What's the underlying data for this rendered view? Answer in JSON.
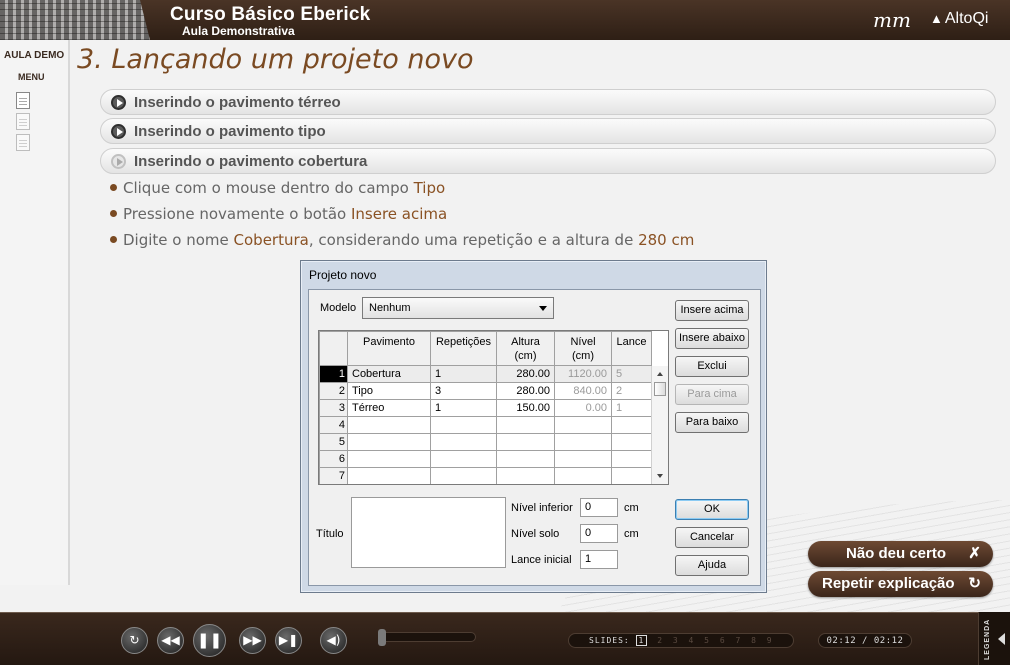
{
  "header": {
    "course_title": "Curso Básico Eberick",
    "course_subtitle": "Aula Demonstrativa",
    "logo_mm": "mm",
    "logo_altoqi": "AltoQi"
  },
  "sidebar": {
    "aula_demo": "AULA DEMO",
    "menu": "MENU"
  },
  "main": {
    "section_title": "3. Lançando um projeto novo",
    "accordion": [
      {
        "label": "Inserindo o pavimento térreo"
      },
      {
        "label": "Inserindo o pavimento tipo"
      },
      {
        "label": "Inserindo o pavimento cobertura"
      }
    ],
    "bullets": [
      {
        "pre": "Clique com o mouse dentro do campo ",
        "hl": "Tipo",
        "post": "",
        "hl2": ""
      },
      {
        "pre": "Pressione novamente o botão ",
        "hl": "Insere acima",
        "post": "",
        "hl2": ""
      },
      {
        "pre": "Digite o nome ",
        "hl": "Cobertura",
        "post": ", considerando uma repetição e a altura de ",
        "hl2": "280 cm"
      }
    ]
  },
  "dialog": {
    "title": "Projeto novo",
    "modelo_label": "Modelo",
    "modelo_value": "Nenhum",
    "columns": [
      "Pavimento",
      "Repetições",
      "Altura\n(cm)",
      "Nível\n(cm)",
      "Lance"
    ],
    "rows": [
      {
        "n": "1",
        "pavimento": "Cobertura",
        "rep": "1",
        "altura": "280.00",
        "nivel": "1120.00",
        "lance": "5"
      },
      {
        "n": "2",
        "pavimento": "Tipo",
        "rep": "3",
        "altura": "280.00",
        "nivel": "840.00",
        "lance": "2"
      },
      {
        "n": "3",
        "pavimento": "Térreo",
        "rep": "1",
        "altura": "150.00",
        "nivel": "0.00",
        "lance": "1"
      },
      {
        "n": "4",
        "pavimento": "",
        "rep": "",
        "altura": "",
        "nivel": "",
        "lance": ""
      },
      {
        "n": "5",
        "pavimento": "",
        "rep": "",
        "altura": "",
        "nivel": "",
        "lance": ""
      },
      {
        "n": "6",
        "pavimento": "",
        "rep": "",
        "altura": "",
        "nivel": "",
        "lance": ""
      },
      {
        "n": "7",
        "pavimento": "",
        "rep": "",
        "altura": "",
        "nivel": "",
        "lance": ""
      }
    ],
    "buttons": {
      "insere_acima": "Insere acima",
      "insere_abaixo": "Insere abaixo",
      "exclui": "Exclui",
      "para_cima": "Para cima",
      "para_baixo": "Para baixo",
      "ok": "OK",
      "cancelar": "Cancelar",
      "ajuda": "Ajuda"
    },
    "titulo_label": "Título",
    "nivel_inferior_label": "Nível  inferior",
    "nivel_inferior_value": "0",
    "nivel_solo_label": "Nível solo",
    "nivel_solo_value": "0",
    "lance_inicial_label": "Lance inicial",
    "lance_inicial_value": "1",
    "unit_cm": "cm"
  },
  "actions": {
    "nao_deu_certo": "Não deu certo",
    "repetir": "Repetir explicação"
  },
  "player": {
    "slides_label": "SLIDES:",
    "slide_current": "1",
    "slides_rest": [
      "2",
      "3",
      "4",
      "5",
      "6",
      "7",
      "8",
      "9"
    ],
    "time": "02:12 / 02:12",
    "legenda": "LEGENDA"
  }
}
